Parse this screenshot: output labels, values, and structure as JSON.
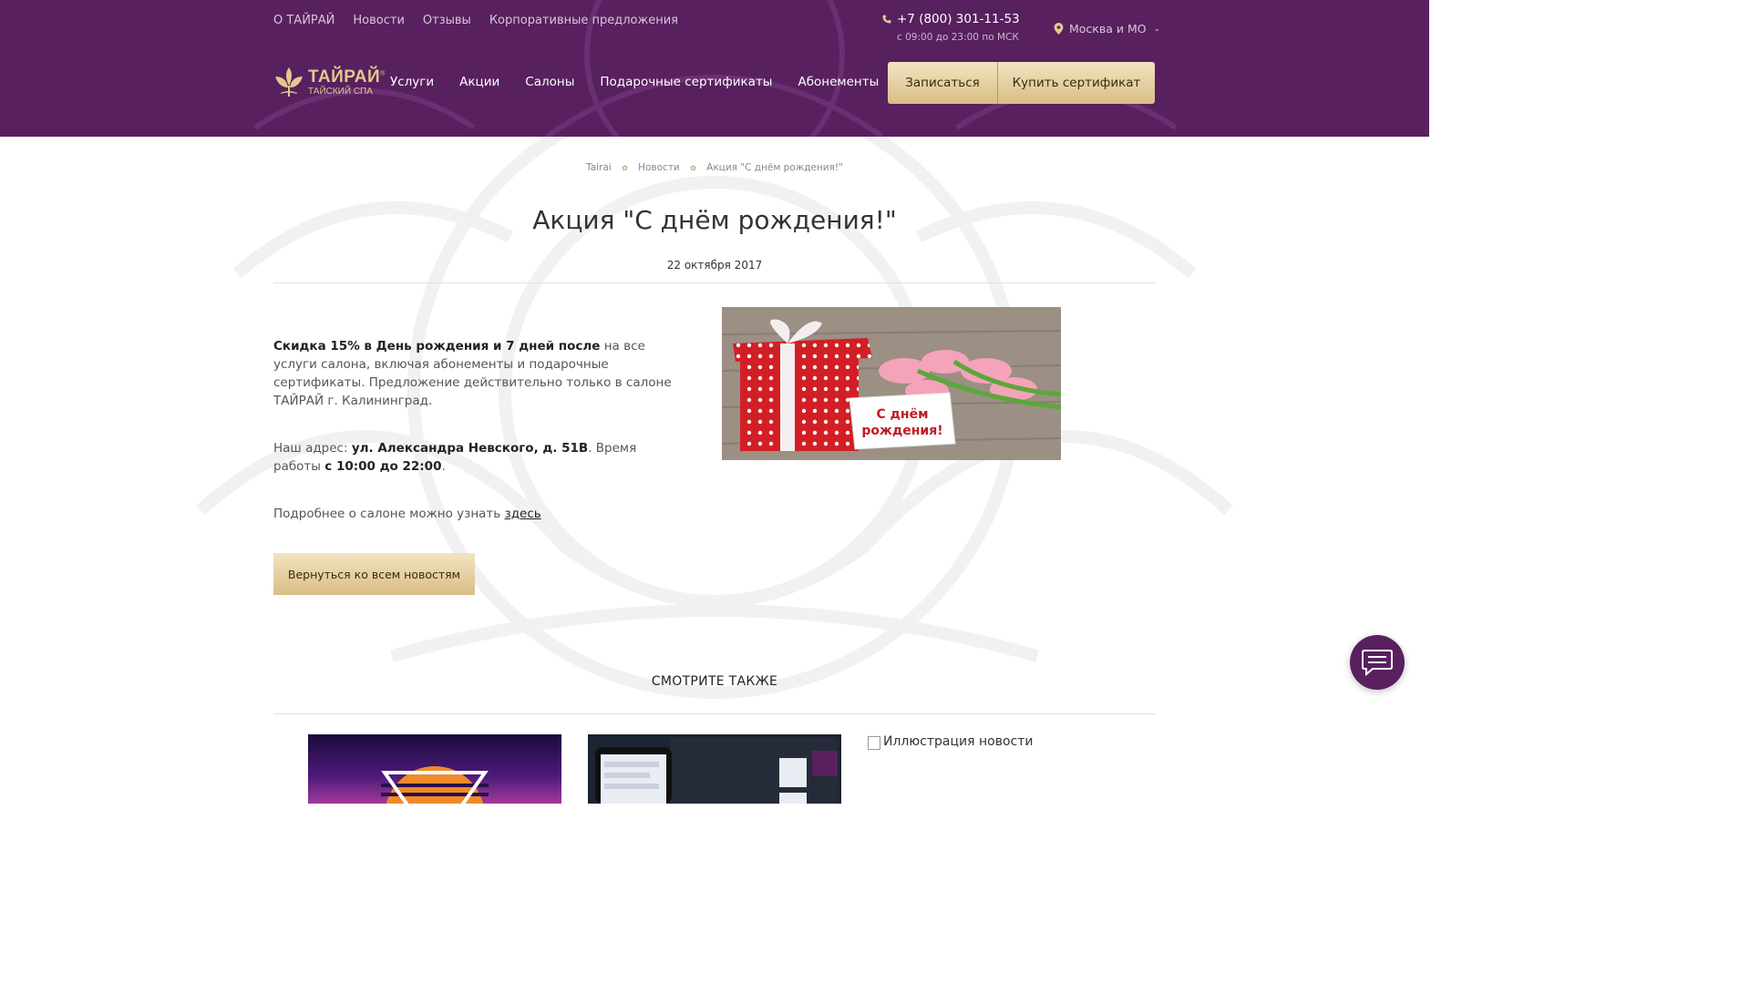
{
  "top_nav": [
    "О ТАЙРАЙ",
    "Новости",
    "Отзывы",
    "Корпоративные предложения"
  ],
  "contact": {
    "phone": "+7 (800) 301-11-53",
    "hours": "с 09:00 до 23:00 по МСК"
  },
  "city": {
    "selected": "Москва и МО"
  },
  "logo": {
    "title": "ТАЙРАЙ",
    "reg": "®",
    "subtitle": "ТАЙСКИЙ СПА"
  },
  "main_nav": [
    "Услуги",
    "Акции",
    "Салоны",
    "Подарочные сертификаты",
    "Абонементы"
  ],
  "header_buttons": {
    "book": "Записаться",
    "buy_cert": "Купить сертификат"
  },
  "breadcrumb": [
    "Tairai",
    "Новости",
    "Акция \"С днём рождения!\""
  ],
  "article": {
    "title": "Акция \"С днём рождения!\"",
    "date": "22 октября 2017",
    "p1_bold": "Скидка 15% в День рождения и 7 дней после",
    "p1_rest": " на все услуги салона, включая абонементы и подарочные сертификаты. Предложение действительно только в салоне ТАЙРАЙ г. Калининград.",
    "p2_prefix": "Наш адрес: ",
    "p2_address": "ул. Александра Невского, д. 51В",
    "p2_mid": ". Время работы ",
    "p2_hours": "с 10:00 до 22:00",
    "p2_end": ".",
    "p3_prefix": "Подробнее о салоне можно узнать ",
    "p3_link": "здесь",
    "image_caption": "С днём\nрождения!"
  },
  "back_button": "Вернуться ко всем новостям",
  "see_also": {
    "title": "СМОТРИТЕ ТАКЖЕ",
    "broken_image_alt": "Иллюстрация новости"
  },
  "colors": {
    "header_bg": "#58205f",
    "gold": "#d9bd85",
    "logo_gold": "#e3c98e"
  }
}
